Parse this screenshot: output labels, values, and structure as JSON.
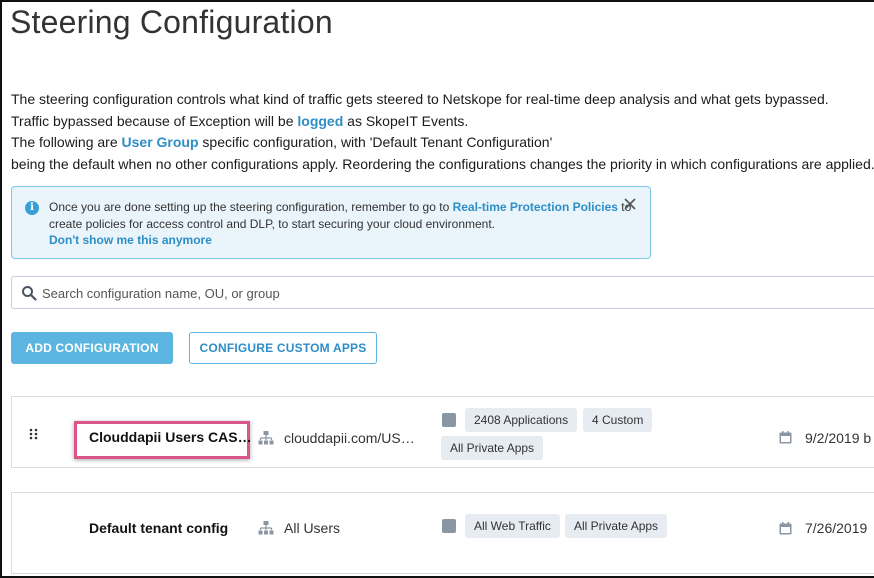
{
  "page": {
    "title": "Steering Configuration",
    "desc_line1": "The steering configuration controls what kind of traffic gets steered to Netskope for real-time deep analysis and what gets bypassed.",
    "desc_line2_pre": "Traffic bypassed because of Exception will be ",
    "desc_line2_link": "logged",
    "desc_line2_post": " as SkopeIT Events.",
    "desc_line3_pre": "The following are ",
    "desc_line3_link": "User Group",
    "desc_line3_post": " specific configuration, with 'Default Tenant Configuration'",
    "desc_line4": "being the default when no other configurations apply. Reordering the configurations changes the priority in which configurations are applied."
  },
  "info_banner": {
    "text_pre": "Once you are done setting up the steering configuration, remember to go to ",
    "link": "Real-time Protection Policies",
    "text_post": " to",
    "line2": "create policies for access control and DLP, to start securing your cloud environment.",
    "dismiss_link": "Don't show me this anymore"
  },
  "search": {
    "placeholder": "Search configuration name, OU, or group",
    "value": ""
  },
  "toolbar": {
    "add_label": "ADD CONFIGURATION",
    "custom_apps_label": "CONFIGURE CUSTOM APPS"
  },
  "configurations": [
    {
      "name": "Clouddapii Users CAS…",
      "ou": "clouddapii.com/US…",
      "tags": [
        "2408 Applications",
        "4 Custom",
        "All Private Apps"
      ],
      "date": "9/2/2019 b"
    },
    {
      "name": "Default tenant config",
      "ou": "All Users",
      "tags": [
        "All Web Traffic",
        "All Private Apps"
      ],
      "date": "7/26/2019"
    }
  ],
  "colors": {
    "accent": "#5bb5e0",
    "link": "#2e8ec7",
    "highlight": "#d9558c",
    "banner_bg": "#e9f5fb"
  },
  "icons": [
    "info-icon",
    "close-icon",
    "search-icon",
    "drag-handle-icon",
    "org-tree-icon",
    "apps-icon",
    "calendar-icon"
  ]
}
